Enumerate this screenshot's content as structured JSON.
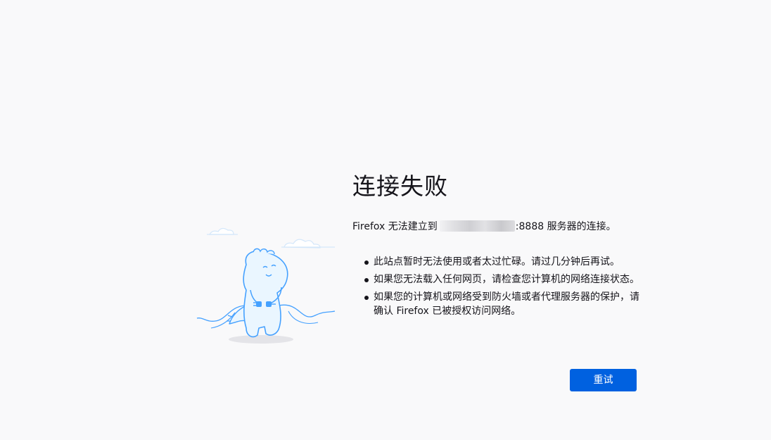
{
  "error": {
    "title": "连接失败",
    "intro_prefix": "Firefox 无法建立到",
    "intro_suffix": ":8888 服务器的连接。",
    "tips": [
      "此站点暂时无法使用或者太过忙碌。请过几分钟后再试。",
      "如果您无法载入任何网页，请检查您计算机的网络连接状态。",
      "如果您的计算机或网络受到防火墙或者代理服务器的保护，请确认 Firefox 已被授权访问网络。"
    ],
    "retry_label": "重试"
  },
  "colors": {
    "background": "#f9f9fa",
    "button": "#0061e0",
    "illustration_stroke": "#45a1ff",
    "illustration_fill": "#eaf6ff"
  },
  "icons": {
    "illustration": "disconnected-dinosaur-illustration"
  }
}
